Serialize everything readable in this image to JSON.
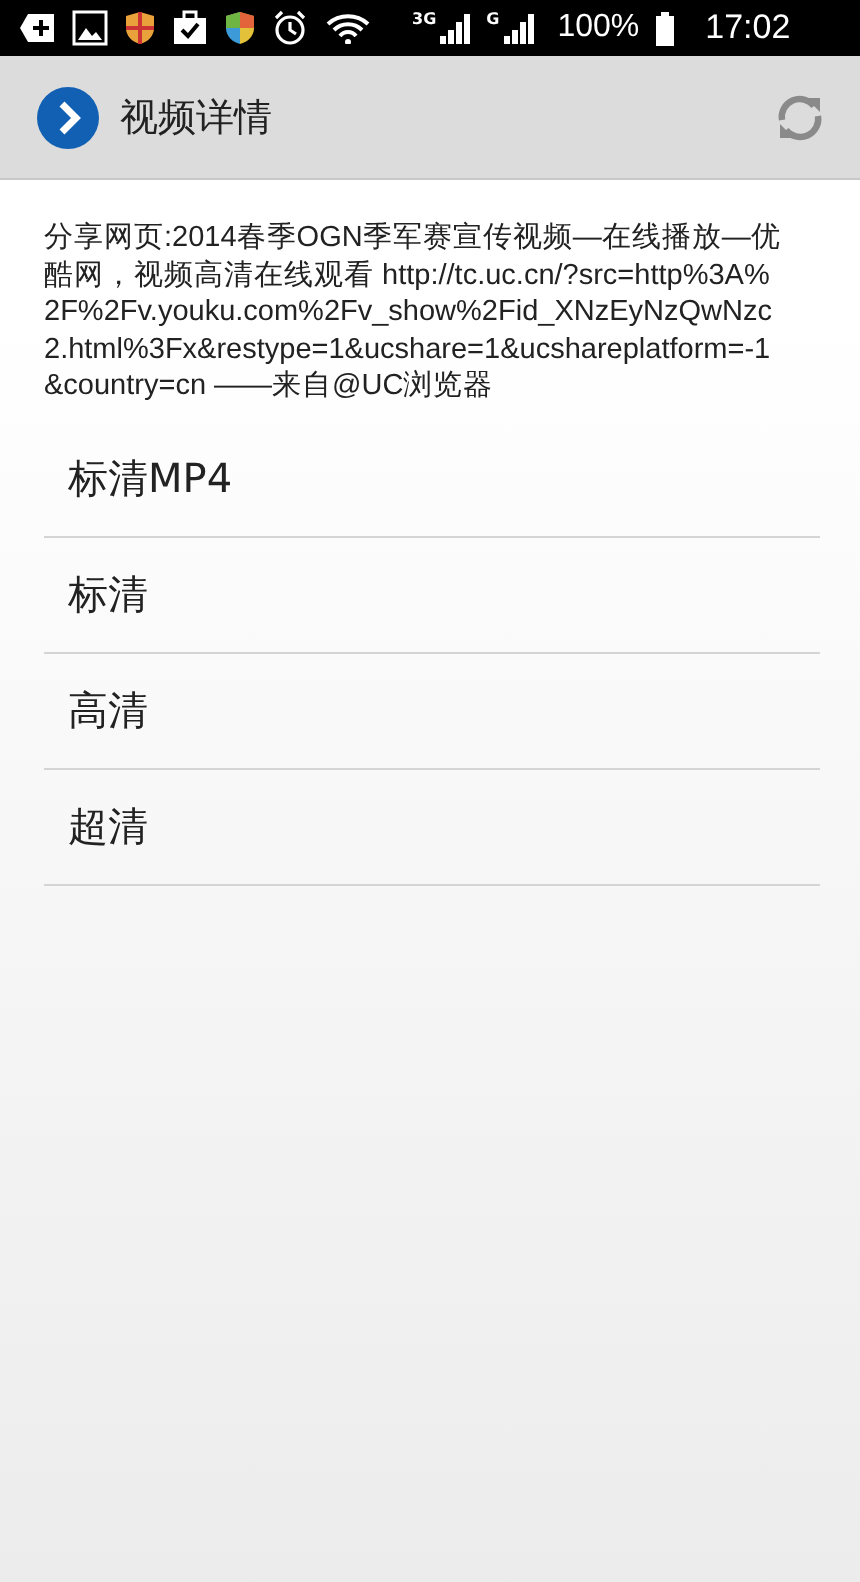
{
  "status_bar": {
    "battery": "100%",
    "time": "17:02",
    "network_1": "3G",
    "network_2": "G"
  },
  "header": {
    "title": "视频详情"
  },
  "share_text": "分享网页:2014春季OGN季军赛宣传视频—在线播放—优酷网，视频高清在线观看 http://tc.uc.cn/?src=http%3A%2F%2Fv.youku.com%2Fv_show%2Fid_XNzEyNzQwNzc2.html%3Fx&restype=1&ucshare=1&ucshareplatform=-1&country=cn ——来自@UC浏览器",
  "options": [
    {
      "label": "标清MP4"
    },
    {
      "label": "标清"
    },
    {
      "label": "高清"
    },
    {
      "label": "超清"
    }
  ]
}
